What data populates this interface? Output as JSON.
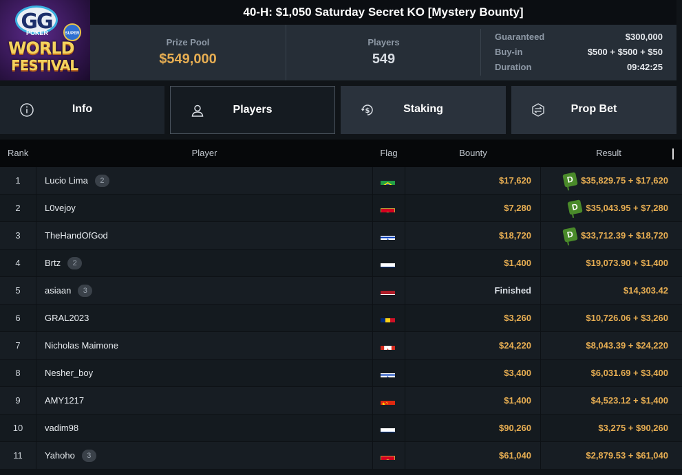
{
  "header": {
    "title": "40-H: $1,050 Saturday Secret KO [Mystery Bounty]",
    "logo": {
      "gg": "GG",
      "poker": "POKER",
      "super": "SUPER",
      "world": "WORLD",
      "festival": "FESTIVAL"
    },
    "prize_pool": {
      "label": "Prize Pool",
      "value": "$549,000"
    },
    "players": {
      "label": "Players",
      "value": "549"
    },
    "details": [
      {
        "label": "Guaranteed",
        "value": "$300,000"
      },
      {
        "label": "Buy-in",
        "value": "$500 + $500 + $50"
      },
      {
        "label": "Duration",
        "value": "09:42:25"
      }
    ]
  },
  "tabs": [
    {
      "label": "Info",
      "icon": "info-icon"
    },
    {
      "label": "Players",
      "icon": "user-icon"
    },
    {
      "label": "Staking",
      "icon": "dollar-coin-icon"
    },
    {
      "label": "Prop Bet",
      "icon": "prop-bet-icon"
    }
  ],
  "table": {
    "columns": {
      "rank": "Rank",
      "player": "Player",
      "flag": "Flag",
      "bounty": "Bounty",
      "result": "Result"
    },
    "rows": [
      {
        "rank": "1",
        "player": "Lucio Lima",
        "badge": "2",
        "flag": "brazil",
        "bounty": "$17,620",
        "result": "$35,829.75 + $17,620",
        "dtag": "D"
      },
      {
        "rank": "2",
        "player": "L0vejoy",
        "badge": "",
        "flag": "montenegro",
        "bounty": "$7,280",
        "result": "$35,043.95 + $7,280",
        "dtag": "D"
      },
      {
        "rank": "3",
        "player": "TheHandOfGod",
        "badge": "",
        "flag": "israel",
        "bounty": "$18,720",
        "result": "$33,712.39 + $18,720",
        "dtag": "D"
      },
      {
        "rank": "4",
        "player": "Brtz",
        "badge": "2",
        "flag": "russia",
        "bounty": "$1,400",
        "result": "$19,073.90 + $1,400",
        "dtag": ""
      },
      {
        "rank": "5",
        "player": "asiaan",
        "badge": "3",
        "flag": "netherlands",
        "bounty": "Finished",
        "result": "$14,303.42",
        "dtag": ""
      },
      {
        "rank": "6",
        "player": "GRAL2023",
        "badge": "",
        "flag": "romania",
        "bounty": "$3,260",
        "result": "$10,726.06 + $3,260",
        "dtag": ""
      },
      {
        "rank": "7",
        "player": "Nicholas Maimone",
        "badge": "",
        "flag": "canada",
        "bounty": "$24,220",
        "result": "$8,043.39 + $24,220",
        "dtag": ""
      },
      {
        "rank": "8",
        "player": "Nesher_boy",
        "badge": "",
        "flag": "israel",
        "bounty": "$3,400",
        "result": "$6,031.69 + $3,400",
        "dtag": ""
      },
      {
        "rank": "9",
        "player": "AMY1217",
        "badge": "",
        "flag": "china",
        "bounty": "$1,400",
        "result": "$4,523.12 + $1,400",
        "dtag": ""
      },
      {
        "rank": "10",
        "player": "vadim98",
        "badge": "",
        "flag": "russia",
        "bounty": "$90,260",
        "result": "$3,275 + $90,260",
        "dtag": ""
      },
      {
        "rank": "11",
        "player": "Yahoho",
        "badge": "3",
        "flag": "montenegro",
        "bounty": "$61,040",
        "result": "$2,879.53 + $61,040",
        "dtag": ""
      }
    ]
  }
}
